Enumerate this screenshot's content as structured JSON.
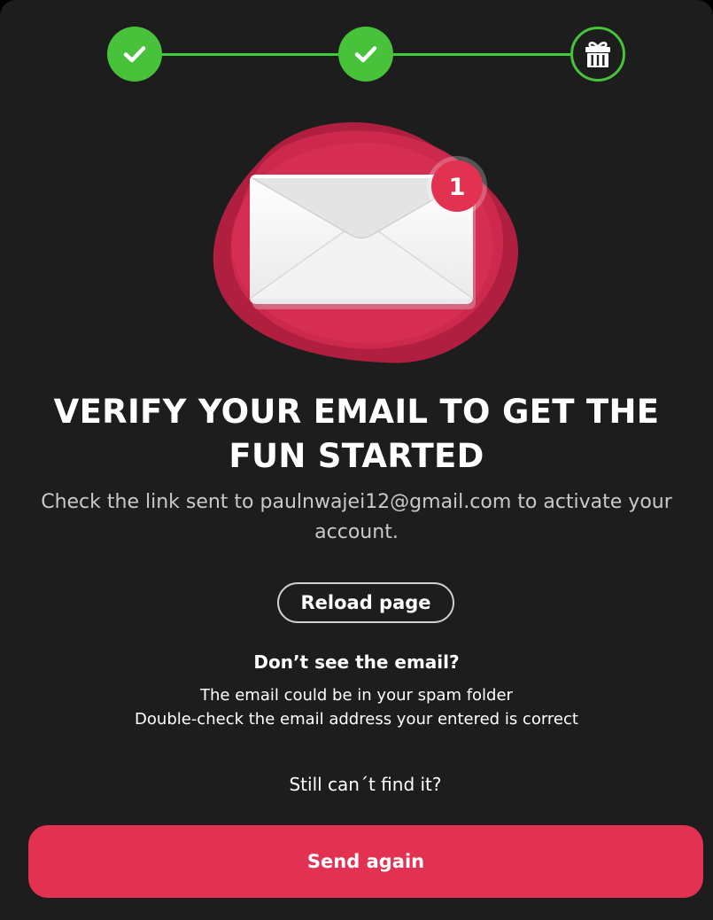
{
  "stepper": {
    "steps": [
      {
        "state": "completed",
        "icon": "checkmark-icon"
      },
      {
        "state": "completed",
        "icon": "checkmark-icon"
      },
      {
        "state": "current",
        "icon": "gift-icon"
      }
    ],
    "accent_color": "#47c23a"
  },
  "illustration": {
    "icon": "envelope-icon",
    "notification_count": "1",
    "blob_color": "#c8234a"
  },
  "headline": {
    "line1": "VERIFY YOUR EMAIL TO GET THE",
    "line2": "FUN STARTED"
  },
  "subtitle": {
    "line1": "Check the link sent to paulnwajei12@gmail.com to activate your",
    "line2": "account."
  },
  "reload_button": {
    "label": "Reload page"
  },
  "help": {
    "title": "Don’t see the email?",
    "line1": "The email could be in your spam folder",
    "line2": "Double-check the email address your entered is correct"
  },
  "still_text": "Still can´t find it?",
  "send_again_button": {
    "label": "Send again",
    "color": "#e33152"
  },
  "colors": {
    "background": "#1d1d1d",
    "text": "#ffffff",
    "muted_text": "#c9c9c9"
  }
}
